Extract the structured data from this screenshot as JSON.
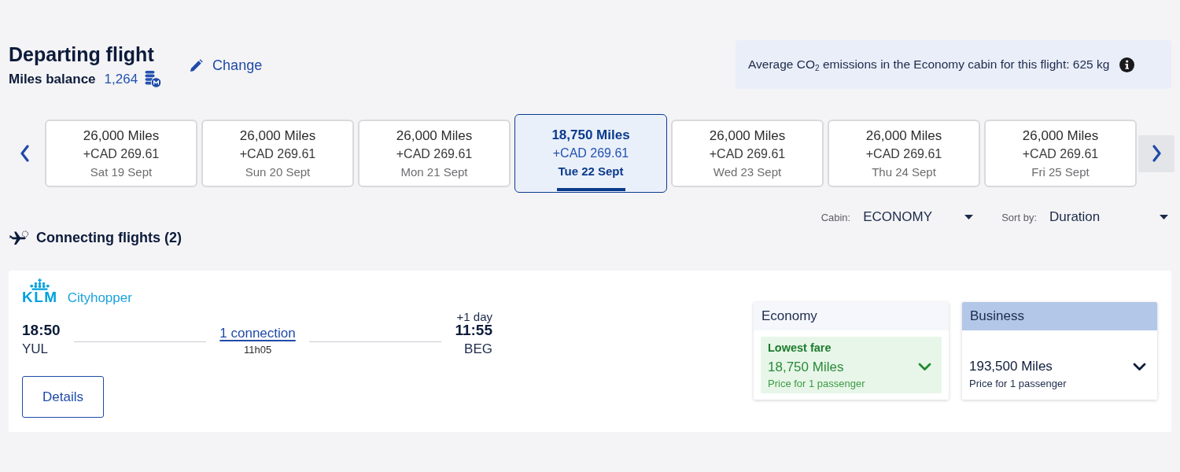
{
  "header": {
    "title": "Departing flight",
    "miles_balance_label": "Miles balance",
    "miles_balance_value": "1,264",
    "change_link": "Change"
  },
  "emissions_notice": {
    "text": "Average CO$_{2}$ emissions in the Economy cabin for this flight: 625 kg"
  },
  "date_carousel": {
    "dates": [
      {
        "miles": "26,000 Miles",
        "cash": "+CAD 269.61",
        "date": "Sat 19 Sept",
        "selected": false
      },
      {
        "miles": "26,000 Miles",
        "cash": "+CAD 269.61",
        "date": "Sun 20 Sept",
        "selected": false
      },
      {
        "miles": "26,000 Miles",
        "cash": "+CAD 269.61",
        "date": "Mon 21 Sept",
        "selected": false
      },
      {
        "miles": "18,750 Miles",
        "cash": "+CAD 269.61",
        "date": "Tue 22 Sept",
        "selected": true
      },
      {
        "miles": "26,000 Miles",
        "cash": "+CAD 269.61",
        "date": "Wed 23 Sept",
        "selected": false
      },
      {
        "miles": "26,000 Miles",
        "cash": "+CAD 269.61",
        "date": "Thu 24 Sept",
        "selected": false
      },
      {
        "miles": "26,000 Miles",
        "cash": "+CAD 269.61",
        "date": "Fri 25 Sept",
        "selected": false
      }
    ]
  },
  "filters": [
    {
      "label": "Cabin:",
      "value": "ECONOMY"
    },
    {
      "label": "Sort by:",
      "value": "Duration"
    }
  ],
  "results_heading": "Connecting flights (2)",
  "flights": [
    {
      "airline": {
        "logo_text": "KLM",
        "name": "Cityhopper"
      },
      "departure": {
        "time": "18:50",
        "airport": "YUL"
      },
      "connection": "1 connection",
      "duration": "11h05",
      "arrival": {
        "day_offset": "+1 day",
        "time": "11:55",
        "airport": "BEG"
      },
      "details_button": "Details",
      "fares": [
        {
          "kind": "lowest",
          "cabin": "Economy",
          "badge": "Lowest fare",
          "price": "18,750 Miles",
          "note": "Price for 1 passenger"
        },
        {
          "kind": "standard",
          "cabin": "Business",
          "price": "193,500 Miles",
          "note": "Price for 1 passenger"
        }
      ]
    }
  ]
}
